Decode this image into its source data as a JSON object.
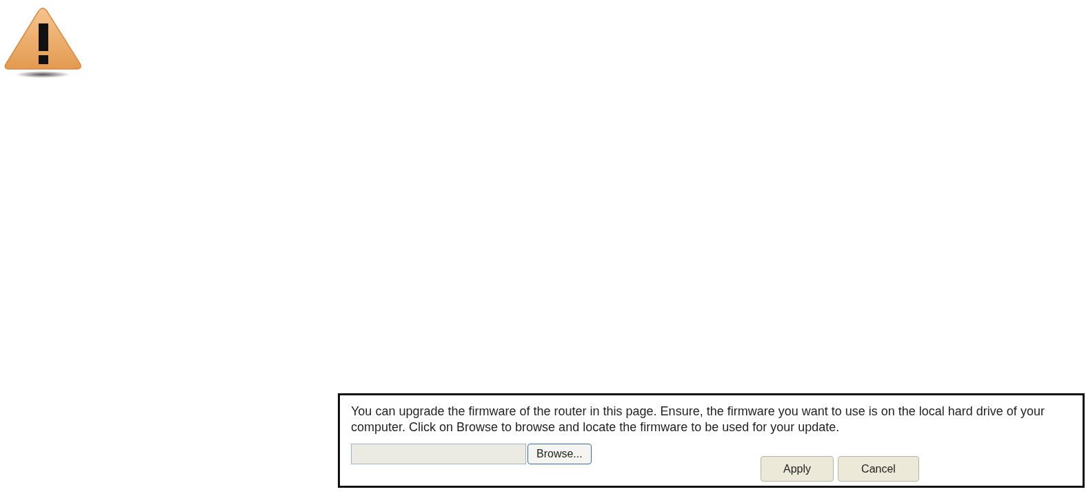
{
  "description": "You can upgrade the firmware of the router in this page. Ensure, the firmware you want to use is on the local hard drive of your computer. Click on Browse to browse and locate the firmware to be used for your update.",
  "browse_button": "Browse...",
  "buttons": [
    "Apply",
    "Cancel"
  ]
}
